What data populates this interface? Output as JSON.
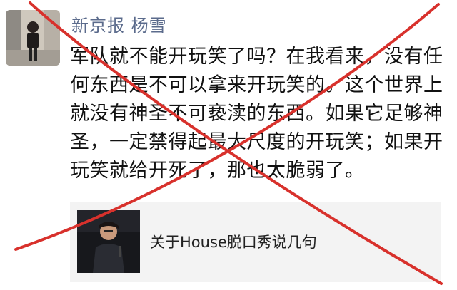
{
  "post": {
    "author": "新京报 杨雪",
    "lines": [
      "军队就不能开玩笑了吗？在我看来，没有任",
      "何东西是不可以拿来开玩笑的。这个世界上",
      "就没有神圣不可亵渎的东西。如果它足够神",
      "圣，一定禁得起最大尺度的开玩笑；如果开",
      "玩笑就给开死了，那也太脆弱了。"
    ]
  },
  "link_card": {
    "title": "关于House脱口秀说几句"
  },
  "overlay": {
    "mark": "red-x-cross-out",
    "color": "#d8312c"
  }
}
